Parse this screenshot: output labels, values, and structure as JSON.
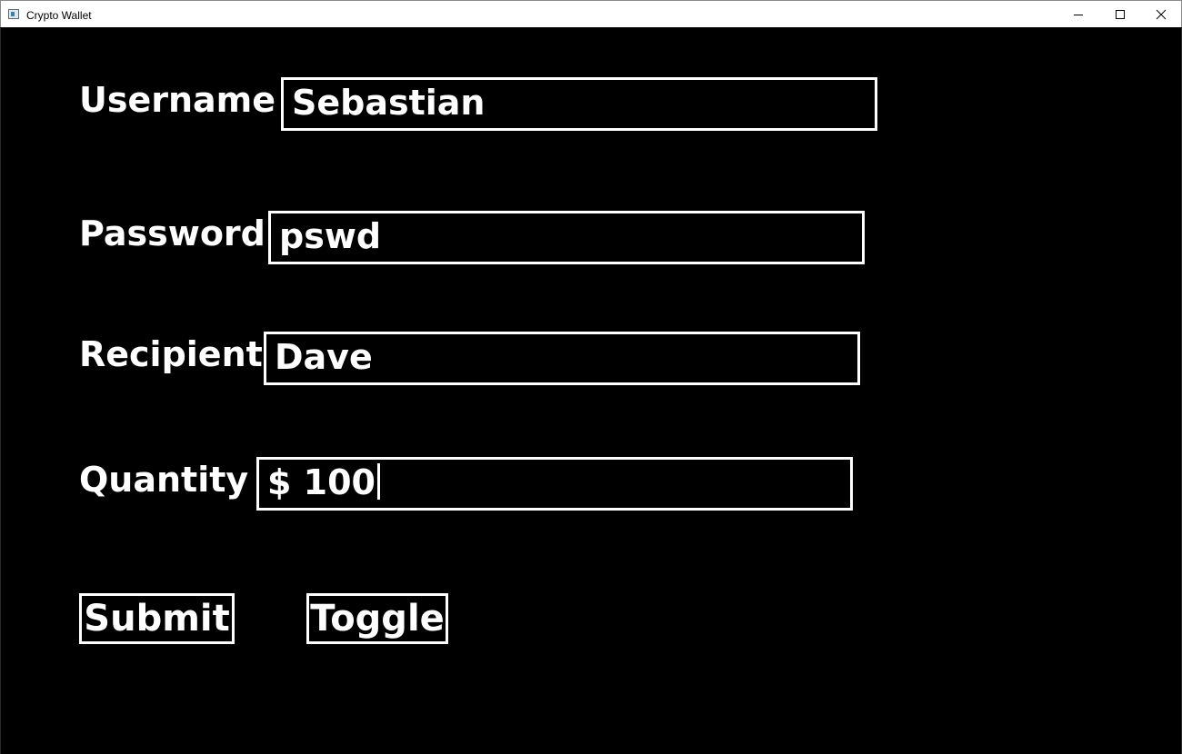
{
  "window": {
    "title": "Crypto Wallet",
    "icon": "app-window-icon",
    "controls": {
      "minimize_icon": "minimize-icon",
      "maximize_icon": "maximize-icon",
      "close_icon": "close-icon"
    }
  },
  "form": {
    "username": {
      "label": "Username",
      "value": "Sebastian"
    },
    "password": {
      "label": "Password",
      "value": "pswd"
    },
    "recipient": {
      "label": "Recipient",
      "value": "Dave"
    },
    "quantity": {
      "label": "Quantity",
      "value": "$ 100"
    }
  },
  "buttons": {
    "submit": "Submit",
    "toggle": "Toggle"
  },
  "colors": {
    "background": "#000000",
    "foreground": "#ffffff",
    "titlebar": "#ffffff"
  }
}
